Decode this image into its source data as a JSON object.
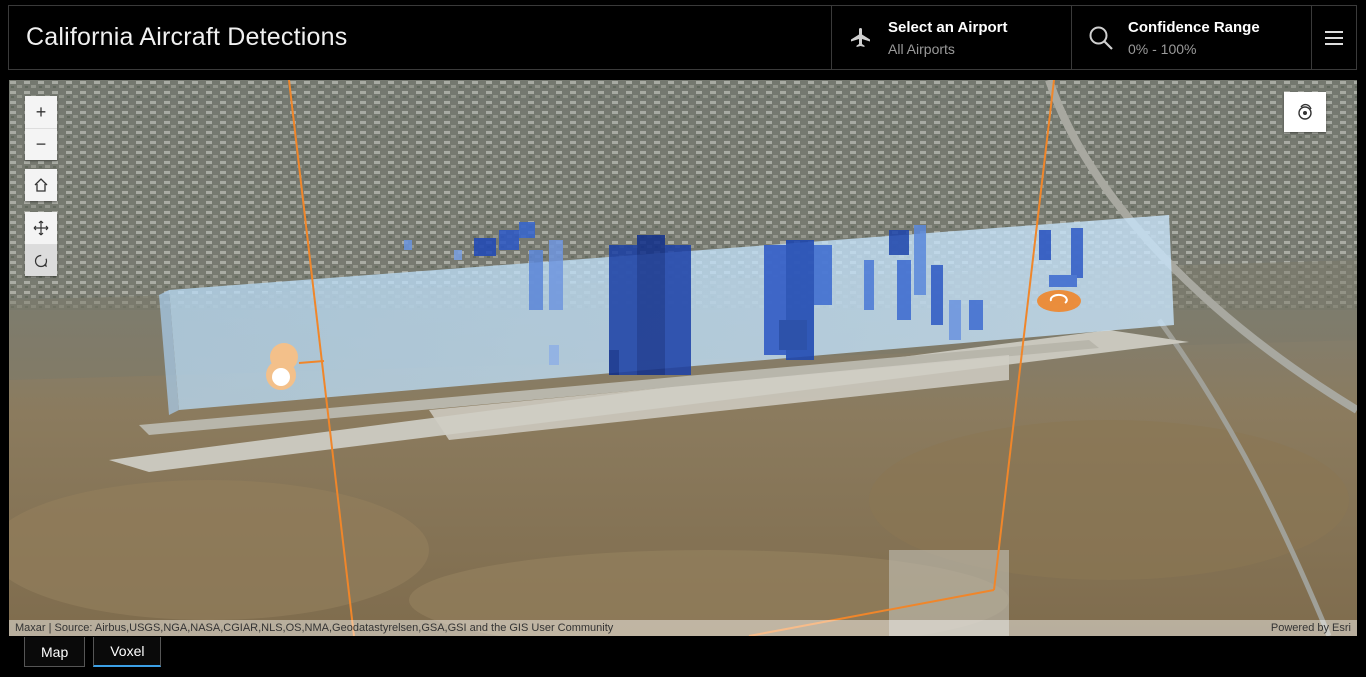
{
  "header": {
    "title": "California Aircraft Detections",
    "airport": {
      "label": "Select an Airport",
      "value": "All Airports"
    },
    "confidence": {
      "label": "Confidence Range",
      "value": "0% - 100%"
    }
  },
  "map_controls": {
    "zoom_in": "+",
    "zoom_out": "−"
  },
  "attribution": {
    "source": "Maxar | Source: Airbus,USGS,NGA,NASA,CGIAR,NLS,OS,NMA,Geodatastyrelsen,GSA,GSI and the GIS User Community",
    "powered_by": "Powered by Esri"
  },
  "tabs": [
    {
      "label": "Map",
      "active": false
    },
    {
      "label": "Voxel",
      "active": true
    }
  ],
  "colors": {
    "voxel_light": "#b9dcf7",
    "voxel_dark": "#0b2a8a",
    "accent_orange": "#f0862a",
    "tab_active": "#3ca0e6"
  }
}
